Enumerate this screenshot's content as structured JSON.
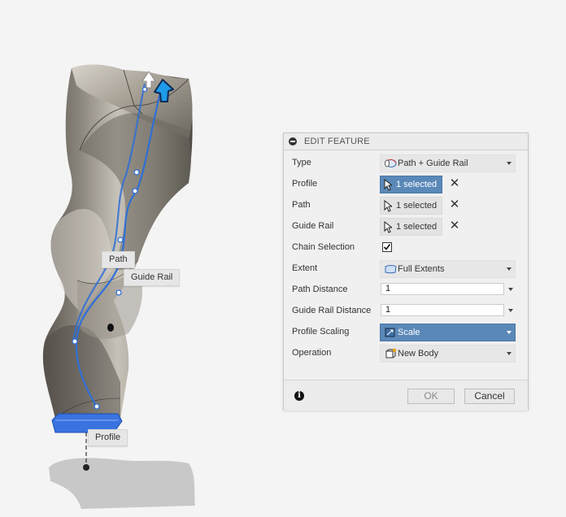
{
  "viewport": {
    "labels": {
      "path": "Path",
      "guide_rail": "Guide Rail",
      "profile": "Profile"
    }
  },
  "panel": {
    "title": "EDIT FEATURE",
    "rows": {
      "type": {
        "label": "Type",
        "value": "Path + Guide Rail"
      },
      "profile": {
        "label": "Profile",
        "value": "1 selected"
      },
      "path": {
        "label": "Path",
        "value": "1 selected"
      },
      "guide_rail": {
        "label": "Guide Rail",
        "value": "1 selected"
      },
      "chain_selection": {
        "label": "Chain Selection",
        "checked": true
      },
      "extent": {
        "label": "Extent",
        "value": "Full Extents"
      },
      "path_distance": {
        "label": "Path Distance",
        "value": "1"
      },
      "guide_rail_distance": {
        "label": "Guide Rail Distance",
        "value": "1"
      },
      "profile_scaling": {
        "label": "Profile Scaling",
        "value": "Scale"
      },
      "operation": {
        "label": "Operation",
        "value": "New Body"
      }
    },
    "clear_symbol": "✕",
    "info_symbol": "i",
    "footer": {
      "ok_label": "OK",
      "cancel_label": "Cancel"
    }
  },
  "colors": {
    "selection_blue": "#5a88b8",
    "path_blue": "#2f6fd6",
    "profile_blue": "#3a73e0"
  },
  "icons": {
    "panel_header": "collapse-icon",
    "type": "sweep-path-guide-rail-icon",
    "selection": "arrow-cursor-icon",
    "extent": "full-extents-icon",
    "profile_scaling": "scale-icon",
    "operation": "new-body-icon",
    "footer": "info-icon"
  }
}
